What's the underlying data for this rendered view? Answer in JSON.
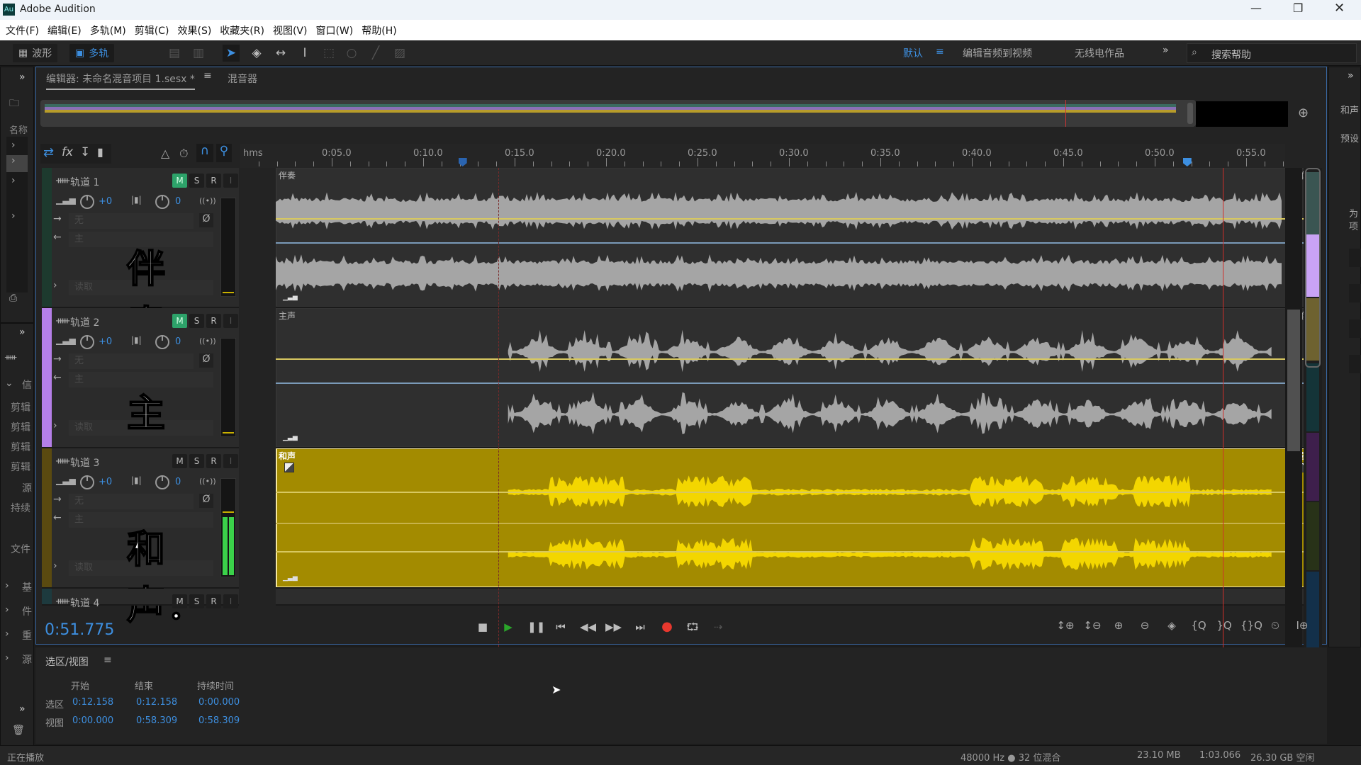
{
  "window": {
    "title": "Adobe Audition",
    "logo": "Au",
    "controls": [
      "minimize-icon",
      "restore-icon",
      "close-icon"
    ]
  },
  "menu": [
    "文件(F)",
    "编辑(E)",
    "多轨(M)",
    "剪辑(C)",
    "效果(S)",
    "收藏夹(R)",
    "视图(V)",
    "窗口(W)",
    "帮助(H)"
  ],
  "toolbar": {
    "waveform": "波形",
    "multitrack": "多轨",
    "workspaces": {
      "default": "默认",
      "edit_video": "编辑音频到视频",
      "radio": "无线电作品"
    },
    "search_placeholder": "搜索帮助"
  },
  "left_panel": {
    "files_label": "名称",
    "props": [
      "信",
      "剪辑",
      "剪辑",
      "剪辑",
      "剪辑",
      "源",
      "持续",
      "文件"
    ],
    "sections": [
      "基",
      "件",
      "重",
      "源"
    ]
  },
  "right_panel": {
    "labels": [
      "和声",
      "预设"
    ],
    "hint": [
      "为",
      "项"
    ]
  },
  "editor": {
    "tab": "编辑器: 未命名混音项目 1.sesx *",
    "mixer_tab": "混音器",
    "time_display": "0:51.775",
    "playhead_seconds": 51.775,
    "selection_seconds": 12.158,
    "view_seconds": [
      0,
      58.309
    ]
  },
  "ruler": {
    "unit": "hms",
    "labels": [
      "0:05.0",
      "0:10.0",
      "0:15.0",
      "0:20.0",
      "0:25.0",
      "0:30.0",
      "0:35.0",
      "0:40.0",
      "0:45.0",
      "0:50.0",
      "0:55.0"
    ]
  },
  "tracks": [
    {
      "name": "轨道 1",
      "volume": "+0",
      "pan": "0",
      "input": "无",
      "output": "主",
      "automation": "读取",
      "overlay": "伴奏：",
      "clip": "伴奏",
      "clip_mode": "声像",
      "mute": true,
      "color": "#1d3a2e"
    },
    {
      "name": "轨道 2",
      "volume": "+0",
      "pan": "0",
      "input": "无",
      "output": "主",
      "automation": "读取",
      "overlay": "主唱：",
      "clip": "主声",
      "clip_mode": "声像",
      "mute": true,
      "color": "#b57fe8"
    },
    {
      "name": "轨道 3",
      "volume": "+0",
      "pan": "0",
      "input": "无",
      "output": "主",
      "automation": "读取",
      "overlay": "和声：",
      "clip": "和声",
      "clip_mode": "音量",
      "mute": false,
      "color": "#5a4a10",
      "selected": true
    },
    {
      "name": "轨道 4",
      "color": "#1d3a3e"
    }
  ],
  "msri": [
    "M",
    "S",
    "R",
    "I"
  ],
  "selection_view": {
    "title": "选区/视图",
    "headers": [
      "开始",
      "结束",
      "持续时间"
    ],
    "rows": [
      {
        "label": "选区",
        "values": [
          "0:12.158",
          "0:12.158",
          "0:00.000"
        ]
      },
      {
        "label": "视图",
        "values": [
          "0:00.000",
          "0:58.309",
          "0:58.309"
        ]
      }
    ]
  },
  "status": {
    "left": "正在播放",
    "format": "48000 Hz ● 32 位混合",
    "size": "23.10 MB",
    "duration": "1:03.066",
    "free": "26.30 GB 空闲"
  },
  "colors": {
    "accent": "#3d8fe0",
    "clip_selected": "#a38b00",
    "waveform_selected": "#f3d600",
    "waveform": "#a5a5a5",
    "playhead": "#d0302a",
    "mute_on": "#2da36a",
    "record": "#e8382e",
    "play": "#2aa52a"
  }
}
